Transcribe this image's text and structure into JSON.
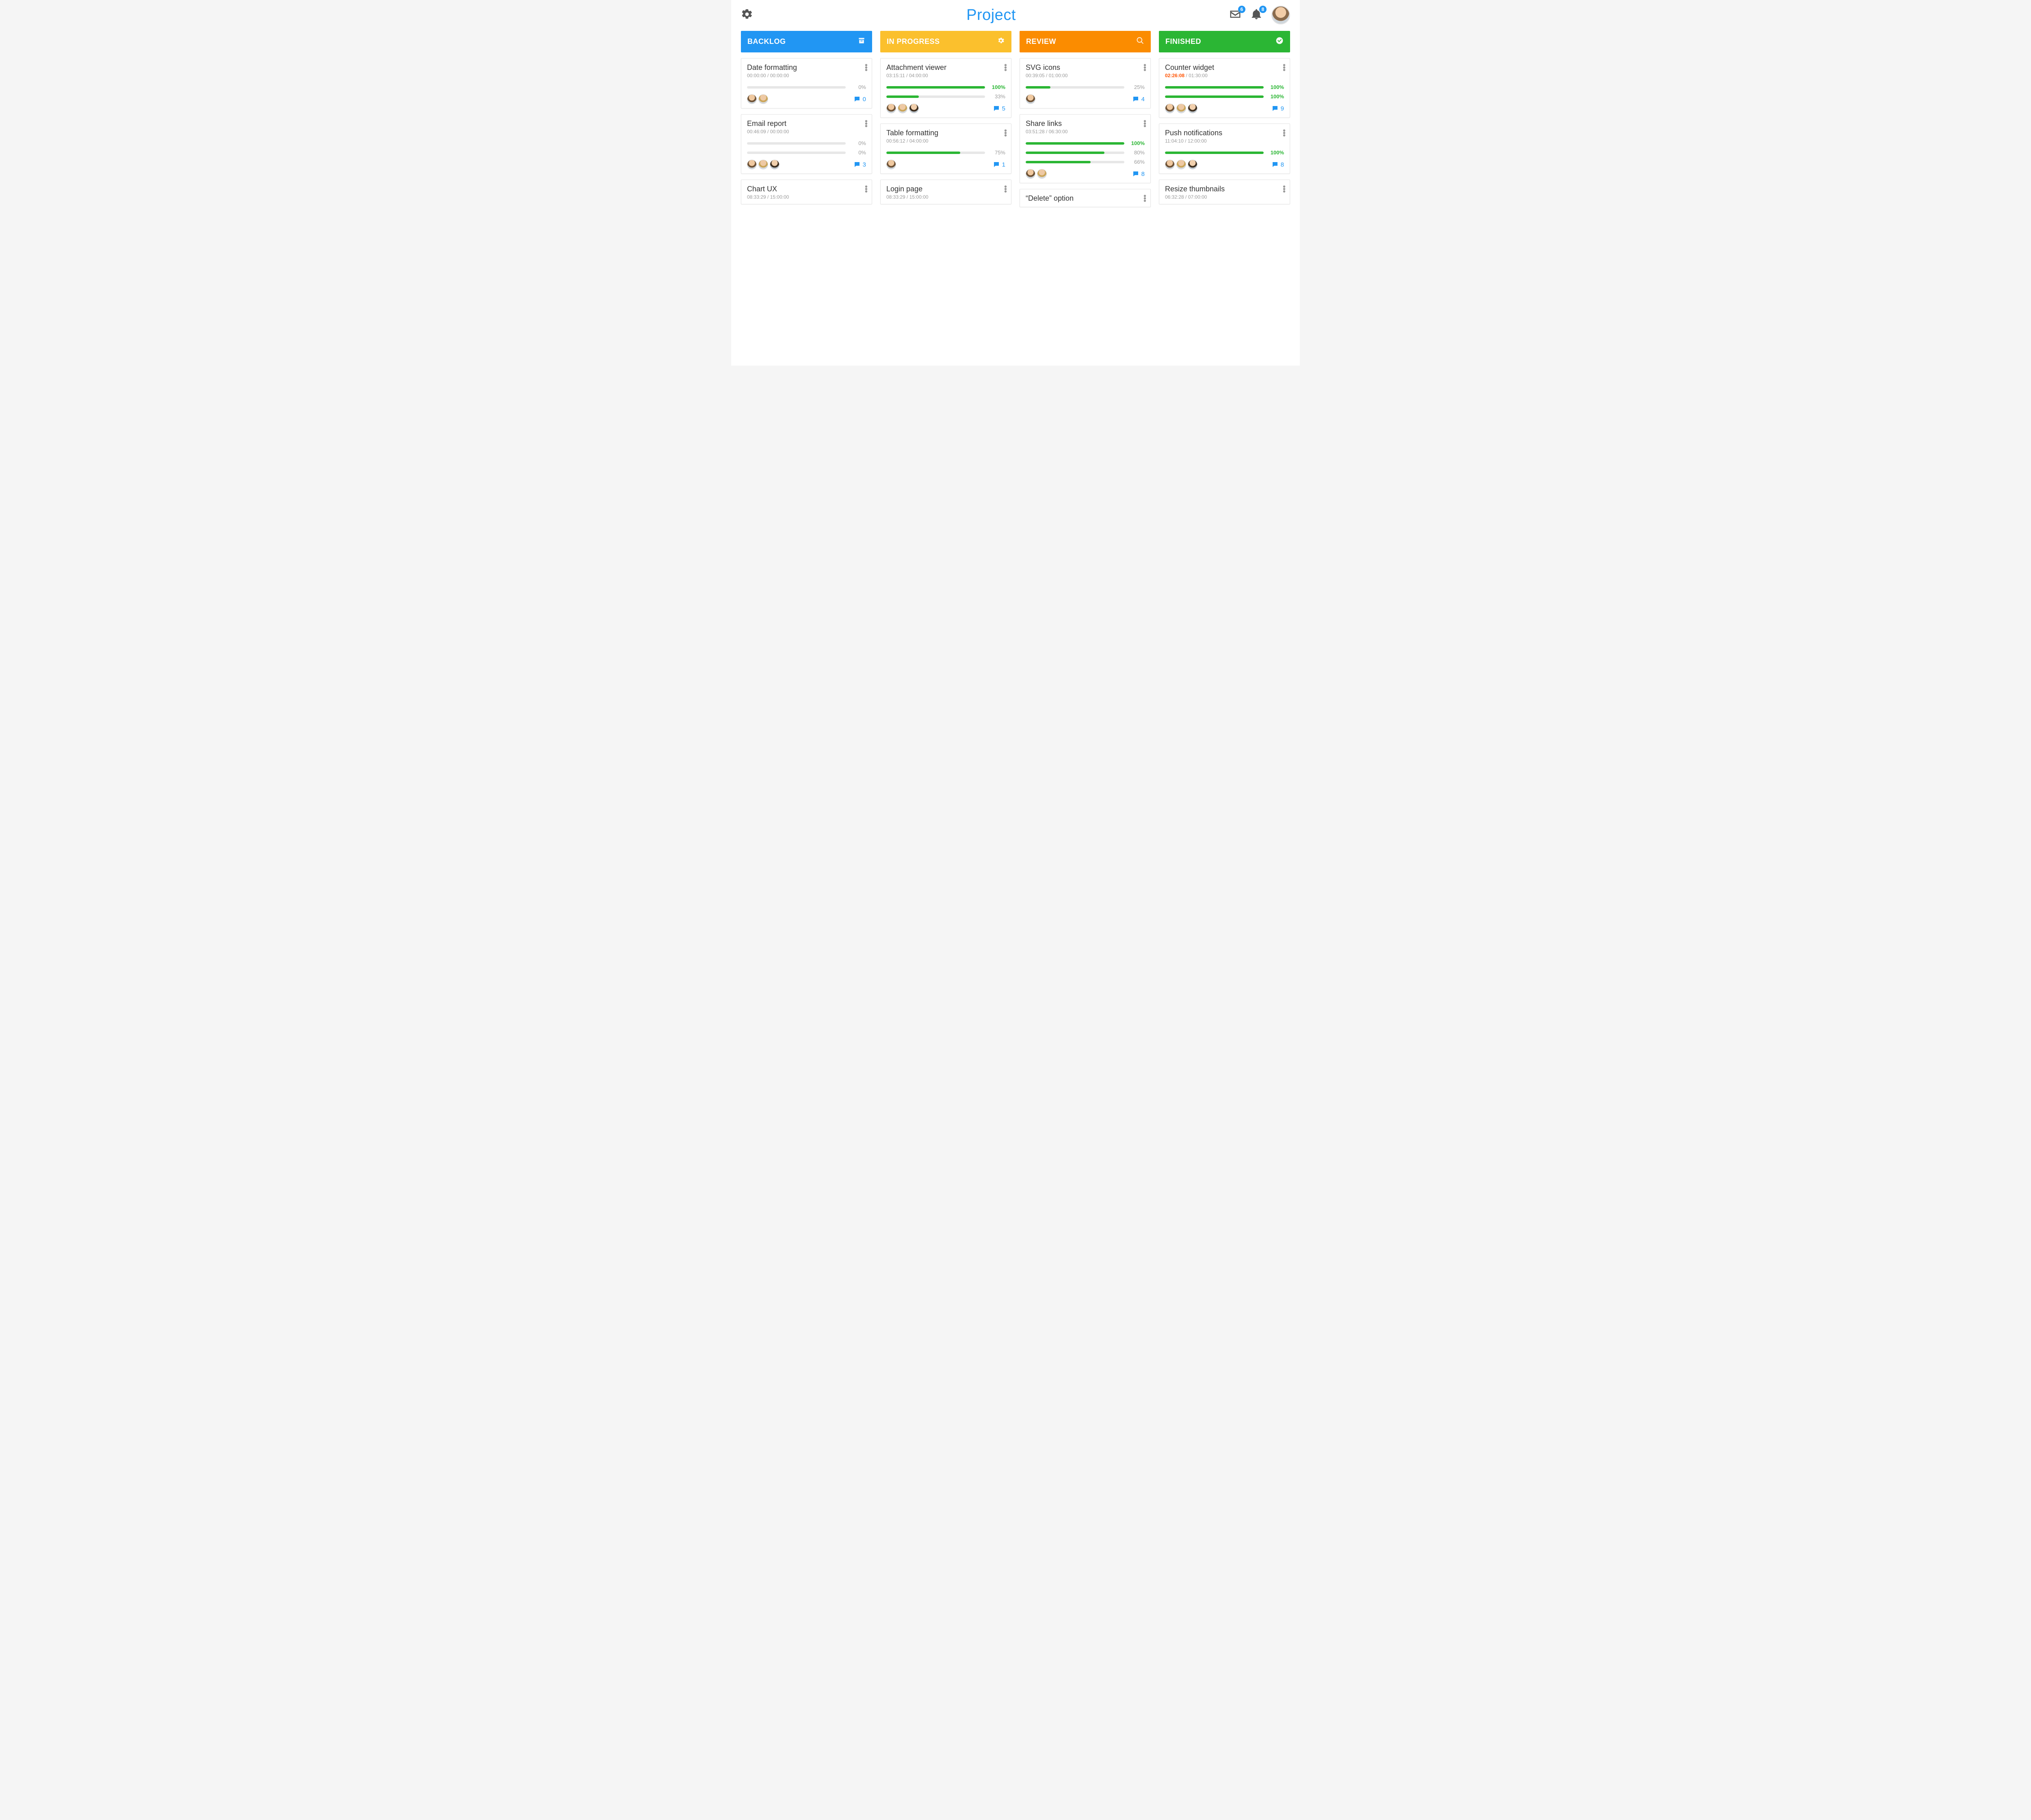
{
  "header": {
    "title": "Project",
    "mail_badge": "6",
    "bell_badge": "8"
  },
  "columns": [
    {
      "key": "backlog",
      "label": "BACKLOG",
      "color_class": "col-backlog",
      "icon": "archive",
      "cards": [
        {
          "title": "Date formatting",
          "elapsed": "00:00:00",
          "planned": "00:00:00",
          "alert": false,
          "bars": [
            {
              "pct": 0
            }
          ],
          "assignees": 2,
          "comments": "0"
        },
        {
          "title": "Email report",
          "elapsed": "00:46:09",
          "planned": "00:00:00",
          "alert": false,
          "bars": [
            {
              "pct": 0
            },
            {
              "pct": 0
            }
          ],
          "assignees": 3,
          "comments": "3"
        },
        {
          "title": "Chart UX",
          "elapsed": "08:33:29",
          "planned": "15:00:00",
          "alert": false,
          "bars": [],
          "assignees": 0,
          "comments": ""
        }
      ]
    },
    {
      "key": "in_progress",
      "label": "IN PROGRESS",
      "color_class": "col-progress",
      "icon": "gear",
      "cards": [
        {
          "title": "Attachment viewer",
          "elapsed": "03:15:11",
          "planned": "04:00:00",
          "alert": false,
          "bars": [
            {
              "pct": 100
            },
            {
              "pct": 33
            }
          ],
          "assignees": 3,
          "comments": "5"
        },
        {
          "title": "Table formatting",
          "elapsed": "00:56:12",
          "planned": "04:00:00",
          "alert": false,
          "bars": [
            {
              "pct": 75
            }
          ],
          "assignees": 1,
          "comments": "1"
        },
        {
          "title": "Login page",
          "elapsed": "08:33:29",
          "planned": "15:00:00",
          "alert": false,
          "bars": [],
          "assignees": 0,
          "comments": ""
        }
      ]
    },
    {
      "key": "review",
      "label": "REVIEW",
      "color_class": "col-review",
      "icon": "search",
      "cards": [
        {
          "title": "SVG icons",
          "elapsed": "00:39:05",
          "planned": "01:00:00",
          "alert": false,
          "bars": [
            {
              "pct": 25
            }
          ],
          "assignees": 1,
          "comments": "4"
        },
        {
          "title": "Share links",
          "elapsed": "03:51:28",
          "planned": "06:30:00",
          "alert": false,
          "bars": [
            {
              "pct": 100
            },
            {
              "pct": 80
            },
            {
              "pct": 66
            }
          ],
          "assignees": 2,
          "comments": "8"
        },
        {
          "title": "“Delete” option",
          "elapsed": "",
          "planned": "",
          "alert": false,
          "bars": [],
          "assignees": 0,
          "comments": ""
        }
      ]
    },
    {
      "key": "finished",
      "label": "FINISHED",
      "color_class": "col-finished",
      "icon": "check",
      "cards": [
        {
          "title": "Counter widget",
          "elapsed": "02:26:08",
          "planned": "01:30:00",
          "alert": true,
          "bars": [
            {
              "pct": 100
            },
            {
              "pct": 100
            }
          ],
          "assignees": 3,
          "comments": "9"
        },
        {
          "title": "Push notifications",
          "elapsed": "11:04:10",
          "planned": "12:00:00",
          "alert": false,
          "bars": [
            {
              "pct": 100
            }
          ],
          "assignees": 3,
          "comments": "8"
        },
        {
          "title": "Resize thumbnails",
          "elapsed": "06:32:28",
          "planned": "07:00:00",
          "alert": false,
          "bars": [],
          "assignees": 0,
          "comments": ""
        }
      ]
    }
  ]
}
